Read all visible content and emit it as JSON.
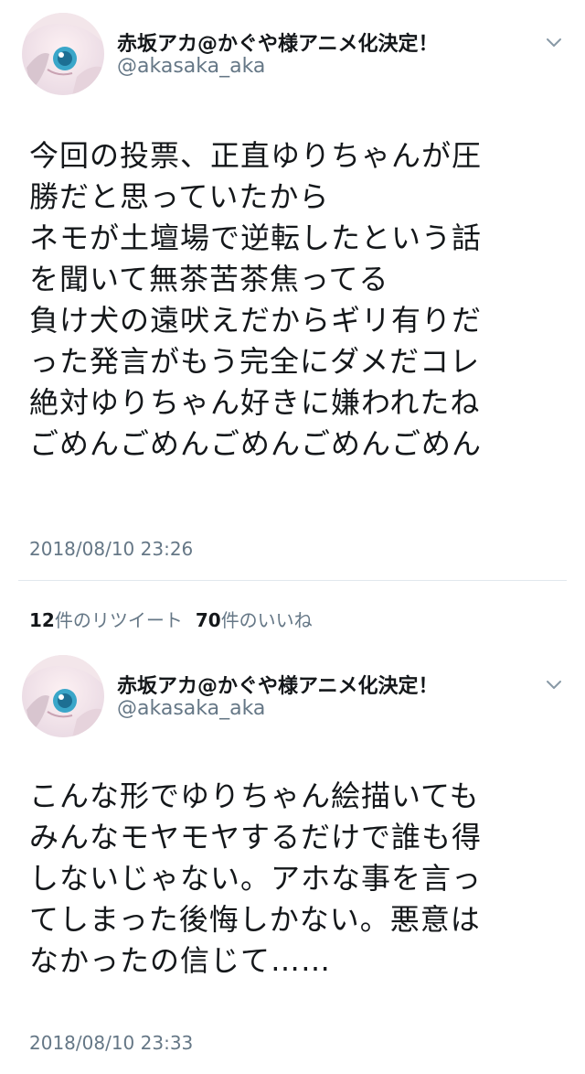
{
  "tweets": [
    {
      "display_name": "赤坂アカ@かぐや様アニメ化決定！",
      "handle": "@akasaka_aka",
      "lines": [
        "今回の投票、正直ゆりちゃんが圧",
        "勝だと思っていたから",
        "ネモが土壇場で逆転したという話",
        "を聞いて無茶苦茶焦ってる",
        "負け犬の遠吠えだからギリ有りだ",
        "った発言がもう完全にダメだコレ",
        "絶対ゆりちゃん好きに嫌われたね",
        "ごめんごめんごめんごめんごめん"
      ],
      "timestamp": "2018/08/10 23:26",
      "stats": {
        "retweet_count": "12",
        "retweet_label": "件のリツイート",
        "like_count": "70",
        "like_label": "件のいいね"
      }
    },
    {
      "display_name": "赤坂アカ@かぐや様アニメ化決定！",
      "handle": "@akasaka_aka",
      "lines": [
        "こんな形でゆりちゃん絵描いても",
        "みんなモヤモヤするだけで誰も得",
        "しないじゃない。アホな事を言っ",
        "てしまった後悔しかない。悪意は",
        "なかったの信じて……"
      ],
      "timestamp": "2018/08/10 23:33"
    }
  ],
  "icons": {
    "menu": "chevron-down-icon",
    "avatar": "avatar-image"
  },
  "colors": {
    "text": "#14171a",
    "secondary": "#657786",
    "divider": "#e1e8ed"
  }
}
